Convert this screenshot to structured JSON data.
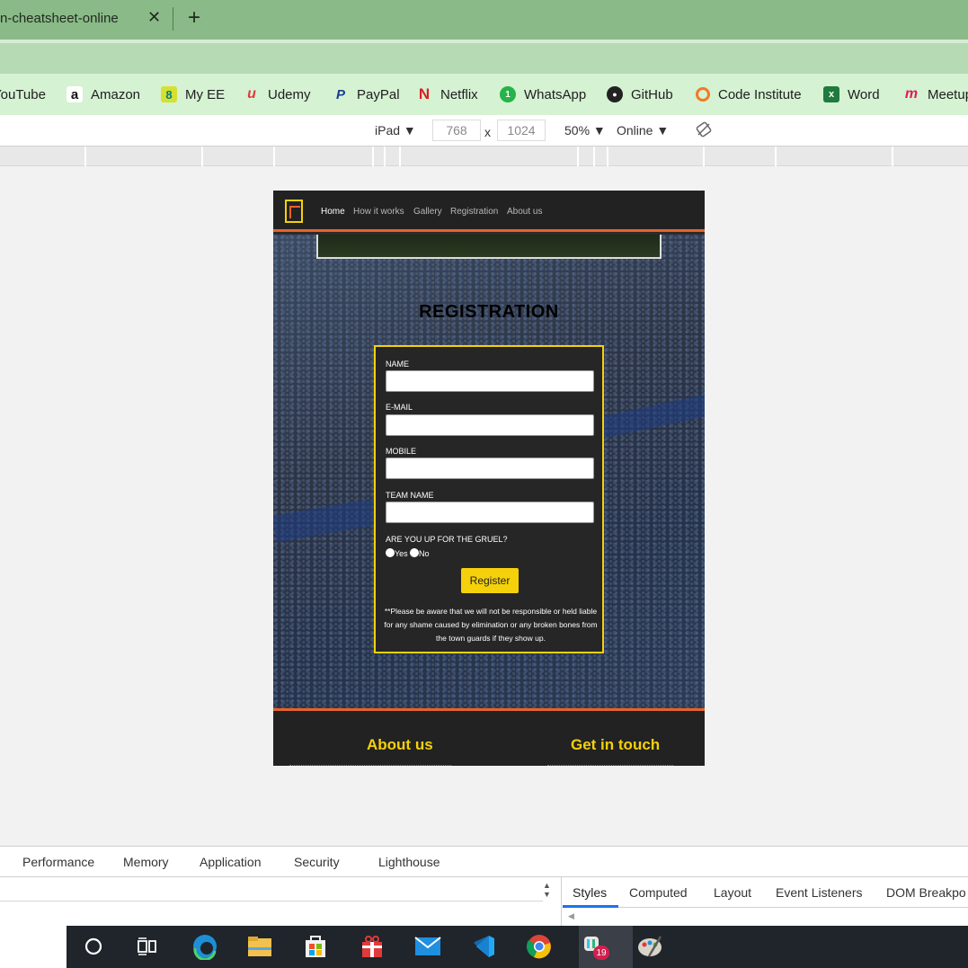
{
  "browser": {
    "tab_title": "n-cheatsheet-online",
    "tab_close": "✕",
    "new_tab": "+"
  },
  "bookmarks": [
    {
      "label": "YouTube",
      "icon": "youtube-icon"
    },
    {
      "label": "Amazon",
      "icon": "amazon-icon"
    },
    {
      "label": "My EE",
      "icon": "ee-icon"
    },
    {
      "label": "Udemy",
      "icon": "udemy-icon"
    },
    {
      "label": "PayPal",
      "icon": "paypal-icon"
    },
    {
      "label": "Netflix",
      "icon": "netflix-icon"
    },
    {
      "label": "WhatsApp",
      "icon": "whatsapp-icon"
    },
    {
      "label": "GitHub",
      "icon": "github-icon"
    },
    {
      "label": "Code Institute",
      "icon": "code-institute-icon"
    },
    {
      "label": "Word",
      "icon": "word-icon"
    },
    {
      "label": "Meetup",
      "icon": "meetup-icon"
    }
  ],
  "device_toolbar": {
    "device": "iPad ▼",
    "width": "768",
    "times": "x",
    "height": "1024",
    "zoom": "50% ▼",
    "network": "Online ▼"
  },
  "site": {
    "nav": [
      "Home",
      "How it works",
      "Gallery",
      "Registration",
      "About us"
    ],
    "title": "REGISTRATION",
    "form": {
      "name_label": "NAME",
      "email_label": "E-MAIL",
      "mobile_label": "MOBILE",
      "team_label": "TEAM NAME",
      "question": "ARE YOU UP FOR THE GRUEL?",
      "yes": "Yes",
      "no": "No",
      "submit": "Register",
      "disclaimer": "**Please be aware that we will not be responsible or held liable for any shame caused by elimination or any broken bones from the town guards if they show up."
    },
    "footer": {
      "about": "About us",
      "contact": "Get in touch"
    }
  },
  "devtools": {
    "tabs": [
      "Performance",
      "Memory",
      "Application",
      "Security",
      "Lighthouse"
    ],
    "style_tabs": [
      "Styles",
      "Computed",
      "Layout",
      "Event Listeners",
      "DOM Breakpo"
    ]
  },
  "taskbar": {
    "chat_badge": "19"
  },
  "colors": {
    "accent_yellow": "#f5d10b",
    "accent_orange": "#e8622a",
    "tab_green": "#8aba87",
    "bookmark_green": "#d5f2d2"
  }
}
